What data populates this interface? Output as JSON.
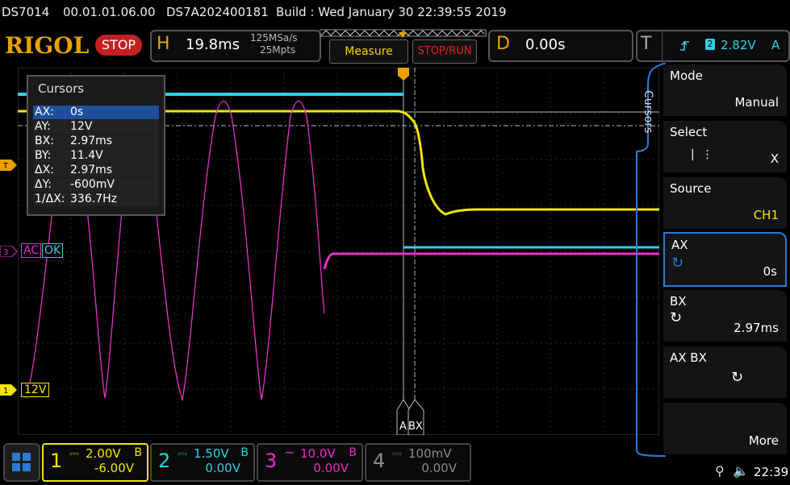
{
  "top_info": {
    "model": "DS7014",
    "firmware": "00.01.01.06.00",
    "serial": "DS7A202400181",
    "build": "Build : Wed January 30 22:39:55 2019"
  },
  "header": {
    "logo": "RIGOL",
    "run_state": "STOP",
    "horizontal": {
      "label": "H",
      "timebase": "19.8ms",
      "sample_rate": "125MSa/s",
      "memory_depth": "25Mpts"
    },
    "measure_label": "Measure",
    "stoprun_label": "STOP/RUN",
    "delay": {
      "label": "D",
      "value": "0.00s"
    },
    "trigger": {
      "label": "T",
      "source": "2",
      "level": "2.82V",
      "coupling": "A"
    }
  },
  "cursor_panel": {
    "title": "Cursors",
    "rows": [
      {
        "key": "AX:",
        "value": "0s"
      },
      {
        "key": "AY:",
        "value": "12V"
      },
      {
        "key": "BX:",
        "value": "2.97ms"
      },
      {
        "key": "BY:",
        "value": "11.4V"
      },
      {
        "key": "ΔX:",
        "value": "2.97ms"
      },
      {
        "key": "ΔY:",
        "value": "-600mV"
      },
      {
        "key": "1/ΔX:",
        "value": "336.7Hz"
      }
    ]
  },
  "markers": {
    "ch3_labels": [
      "AC",
      "OK"
    ],
    "ch1_label": "12V",
    "cursor_a": "A",
    "cursor_b": "BX",
    "trigger_marker": "T"
  },
  "side_menu": {
    "tab": "Cursors",
    "items": [
      {
        "title": "Mode",
        "value": "Manual"
      },
      {
        "title": "Select",
        "value": "X"
      },
      {
        "title": "Source",
        "value": "CH1"
      },
      {
        "title": "AX",
        "value": "0s"
      },
      {
        "title": "BX",
        "value": "2.97ms"
      },
      {
        "title": "AX BX",
        "value": ""
      },
      {
        "title": "",
        "value": "More"
      }
    ]
  },
  "channels": [
    {
      "num": "1",
      "scale": "2.00V",
      "offset": "-6.00V",
      "bw": "B",
      "color": "#f2e600"
    },
    {
      "num": "2",
      "scale": "1.50V",
      "offset": "0.00V",
      "bw": "B",
      "color": "#2fd0e8"
    },
    {
      "num": "3",
      "scale": "10.0V",
      "offset": "0.00V",
      "bw": "B",
      "color": "#e830c8"
    },
    {
      "num": "4",
      "scale": "100mV",
      "offset": "0.00V",
      "bw": "",
      "color": "#8a8a8a"
    }
  ],
  "status_bar": {
    "time": "22:39"
  },
  "colors": {
    "ch1": "#f2e600",
    "ch2": "#2fd0e8",
    "ch3": "#e830c8",
    "accent": "#e8a100",
    "menu_border": "#2a7ad6"
  }
}
